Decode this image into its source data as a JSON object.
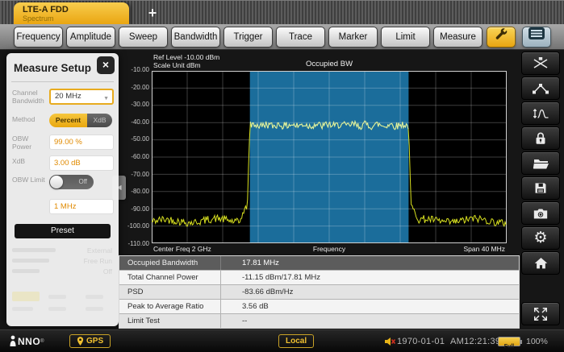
{
  "tab": {
    "title": "LTE-A FDD",
    "subtitle": "Spectrum"
  },
  "icons": {
    "plus": "+",
    "close": "×",
    "dropdown_arrow": "▼",
    "collapse_arrow": "◀",
    "gear": "⚙"
  },
  "toolbar": {
    "buttons": [
      "Frequency",
      "Amplitude",
      "Sweep",
      "Bandwidth",
      "Trigger",
      "Trace",
      "Marker",
      "Limit",
      "Measure"
    ]
  },
  "measure_setup": {
    "title": "Measure Setup",
    "channel_bandwidth": {
      "label": "Channel Bandwidth",
      "value": "20 MHz"
    },
    "method": {
      "label": "Method",
      "selected": "Percent",
      "unselected": "XdB"
    },
    "obw_power": {
      "label": "OBW Power",
      "value": "99.00 %"
    },
    "xdb": {
      "label": "XdB",
      "value": "3.00 dB"
    },
    "obw_limit": {
      "label": "OBW Limit",
      "state": "Off"
    },
    "limit_value": "1 MHz",
    "preset_label": "Preset",
    "ghost_values": [
      "External",
      "Free Run",
      "Off"
    ]
  },
  "chart_data": {
    "type": "line",
    "title": "Occupied BW",
    "ref_level_label": "Ref Level -10.00 dBm",
    "scale_unit_label": "Scale Unit  dBm",
    "xlabel": "Frequency",
    "x_left_label": "Center Freq 2 GHz",
    "x_right_label": "Span  40 MHz",
    "center_freq": "2 GHz",
    "span": "40 MHz",
    "ylim": [
      -110,
      -10
    ],
    "y_ticks": [
      "-10.00",
      "-20.00",
      "-30.00",
      "-40.00",
      "-50.00",
      "-60.00",
      "-70.00",
      "-80.00",
      "-90.00",
      "-100.00",
      "-110.00"
    ],
    "x_divisions": 10,
    "y_divisions": 10,
    "grid": true,
    "occupied_region": {
      "start_frac": 0.2765,
      "end_frac": 0.7235,
      "bandwidth_mhz": 17.81,
      "color": "#1b6d9b"
    },
    "trace": {
      "color": "#d8e020",
      "plateau_color": "#dff0a8",
      "noise_floor_dbm": -97.5,
      "edge_rise_dbm": -88,
      "plateau_dbm": -41.5,
      "noise_amp_db": 2.2,
      "edge_width_frac": 0.007,
      "shoulder_width_frac": 0.028
    }
  },
  "results_table": {
    "rows": [
      {
        "label": "Occupied Bandwidth",
        "value": "17.81 MHz"
      },
      {
        "label": "Total Channel Power",
        "value": "-11.15 dBm/17.81 MHz"
      },
      {
        "label": "PSD",
        "value": "-83.66 dBm/Hz"
      },
      {
        "label": "Peak to Average Ratio",
        "value": "3.56 dB"
      },
      {
        "label": "Limit Test",
        "value": "--"
      }
    ]
  },
  "sidebar": {
    "icons": [
      "auto-tune",
      "peak-search",
      "bandwidth",
      "lock",
      "open-file",
      "save",
      "screenshot",
      "settings",
      "home",
      "fullscreen"
    ]
  },
  "statusbar": {
    "logo": "NNO",
    "gps": "GPS",
    "local": "Local",
    "date": "1970-01-01",
    "time": "AM12:21:39",
    "battery": "Full",
    "battery_pct": "100%"
  },
  "colors": {
    "accent_yellow": "#e9a40f",
    "occupied_blue": "#1b6d9b",
    "trace_yellow": "#d8e020"
  }
}
